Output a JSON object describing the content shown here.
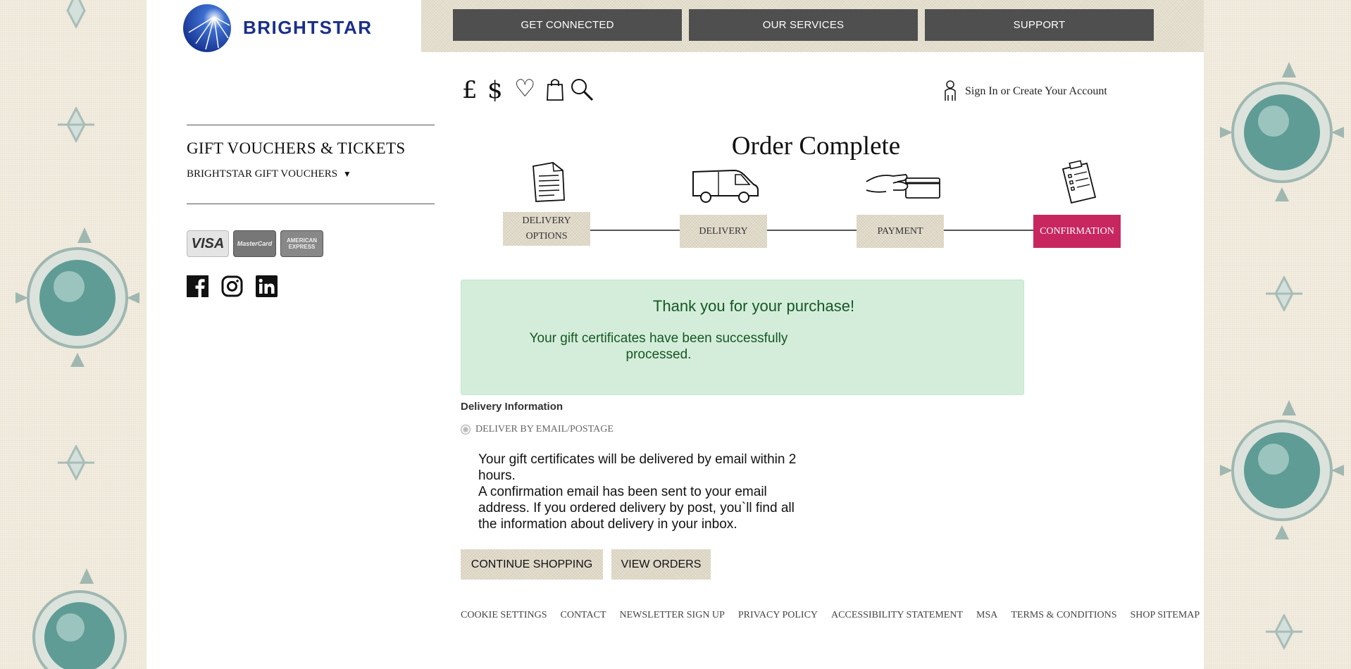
{
  "brand": {
    "name": "BRIGHTSTAR",
    "color": "#1a2f8a"
  },
  "topnav": [
    "GET CONNECTED",
    "OUR SERVICES",
    "SUPPORT"
  ],
  "toolbar_icons": {
    "pound": {
      "glyph": "£",
      "icon": "pound-currency-icon"
    },
    "dollar": {
      "glyph": "$",
      "icon": "dollar-currency-icon"
    },
    "wishlist": {
      "glyph": "♡",
      "icon": "heart-icon"
    },
    "bag": {
      "icon": "shopping-bag-icon"
    },
    "search": {
      "icon": "search-icon"
    }
  },
  "account": {
    "signin": "Sign In or Create Your Account",
    "icon": "user-icon"
  },
  "sidebar": {
    "heading": "GIFT VOUCHERS & TICKETS",
    "link": "BRIGHTSTAR GIFT VOUCHERS",
    "link_caret": "▼"
  },
  "payment_cards": [
    "VISA",
    "MasterCard",
    "AMERICAN EXPRESS"
  ],
  "social": [
    "facebook-icon",
    "instagram-icon",
    "linkedin-icon"
  ],
  "page_title": "Order Complete",
  "steps": [
    {
      "label": "DELIVERY\nOPTIONS",
      "icon": "document-icon"
    },
    {
      "label": "DELIVERY",
      "icon": "van-icon"
    },
    {
      "label": "PAYMENT",
      "icon": "card-payment-icon"
    },
    {
      "label": "CONFIRMATION",
      "icon": "clipboard-icon",
      "active": true
    }
  ],
  "accent_color": "#c8265e",
  "success": {
    "title": "Thank you for your purchase!",
    "message": "Your gift certificates have been successfully processed."
  },
  "delivery": {
    "label": "Delivery Information",
    "option": "DELIVER BY EMAIL/POSTAGE",
    "text_line1": "Your gift certificates will be delivered by email within 2 hours.",
    "text_line2": "A confirmation email has been sent to your email address. If you ordered delivery by post, you`ll find all the information about delivery in your inbox."
  },
  "actions": {
    "continue": "CONTINUE SHOPPING",
    "orders": "VIEW ORDERS"
  },
  "footer": [
    "COOKIE SETTINGS",
    "CONTACT",
    "NEWSLETTER SIGN UP",
    "PRIVACY POLICY",
    "ACCESSIBILITY STATEMENT",
    "MSA",
    "TERMS & CONDITIONS",
    "SHOP SITEMAP"
  ]
}
